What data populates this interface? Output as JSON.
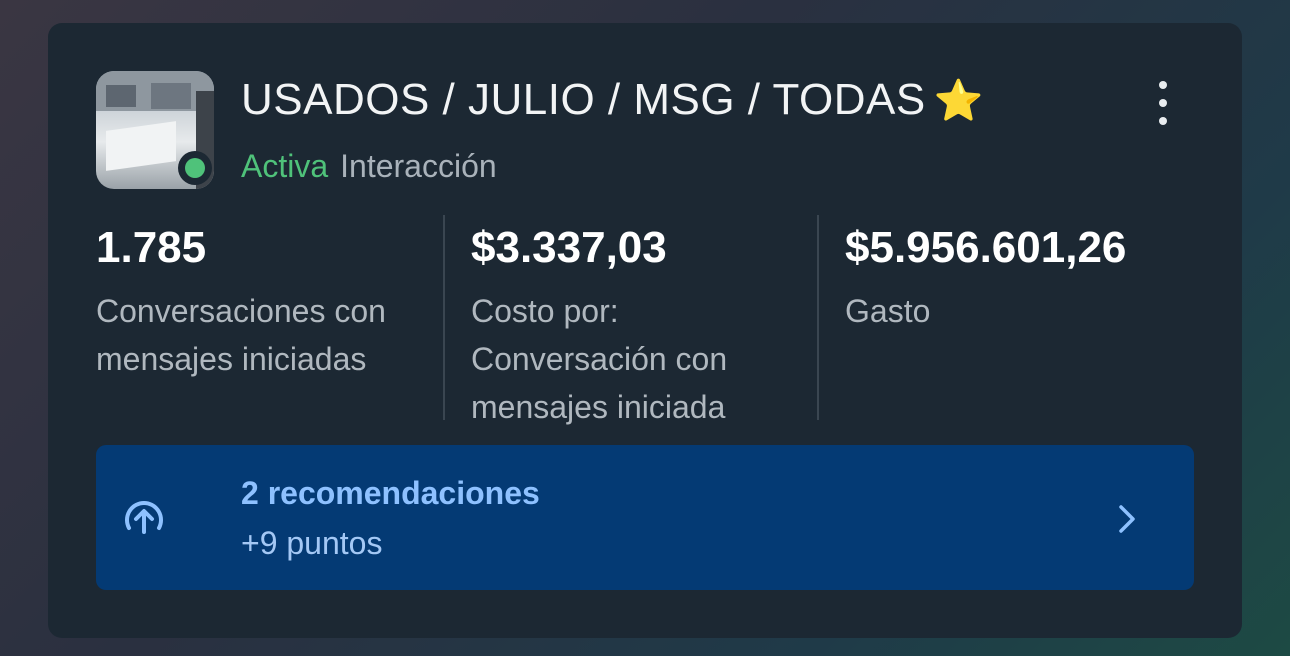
{
  "campaign": {
    "title": "USADOS / JULIO / MSG / TODAS",
    "title_emoji": "⭐",
    "status": "Activa",
    "objective": "Interacción"
  },
  "metrics": [
    {
      "value": "1.785",
      "label": "Conversaciones con\nmensajes iniciadas"
    },
    {
      "value": "$3.337,03",
      "label": "Costo por:\nConversación con\nmensajes iniciada"
    },
    {
      "value": "$5.956.601,26",
      "label": "Gasto"
    }
  ],
  "recommendations": {
    "title": "2 recomendaciones",
    "subtitle": "+9 puntos"
  },
  "icons": {
    "more": "more-vertical-icon",
    "reco": "arrow-up-circle-icon",
    "chevron": "chevron-right-icon"
  },
  "colors": {
    "card_bg": "#1c2833",
    "status_active": "#4fc27a",
    "reco_bg": "#043a74",
    "reco_text": "#8ec1ff"
  }
}
